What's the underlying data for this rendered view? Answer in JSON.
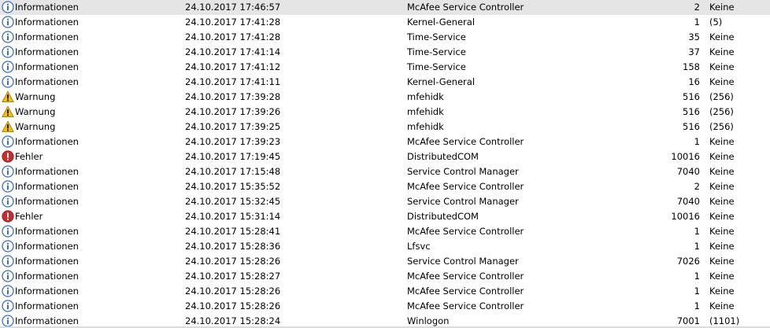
{
  "colors": {
    "selected_row": "#e5e5e5",
    "info_icon": "#3a6fbf",
    "warning_icon": "#f2c200",
    "error_icon": "#cc2b2b"
  },
  "events": [
    {
      "level": "Informationen",
      "icon": "info-icon",
      "datetime": "24.10.2017 17:46:57",
      "source": "McAfee Service Controller",
      "event_id": "2",
      "task_category": "Keine",
      "selected": true
    },
    {
      "level": "Informationen",
      "icon": "info-icon",
      "datetime": "24.10.2017 17:41:28",
      "source": "Kernel-General",
      "event_id": "1",
      "task_category": "(5)"
    },
    {
      "level": "Informationen",
      "icon": "info-icon",
      "datetime": "24.10.2017 17:41:28",
      "source": "Time-Service",
      "event_id": "35",
      "task_category": "Keine"
    },
    {
      "level": "Informationen",
      "icon": "info-icon",
      "datetime": "24.10.2017 17:41:14",
      "source": "Time-Service",
      "event_id": "37",
      "task_category": "Keine"
    },
    {
      "level": "Informationen",
      "icon": "info-icon",
      "datetime": "24.10.2017 17:41:12",
      "source": "Time-Service",
      "event_id": "158",
      "task_category": "Keine"
    },
    {
      "level": "Informationen",
      "icon": "info-icon",
      "datetime": "24.10.2017 17:41:11",
      "source": "Kernel-General",
      "event_id": "16",
      "task_category": "Keine"
    },
    {
      "level": "Warnung",
      "icon": "warning-icon",
      "datetime": "24.10.2017 17:39:28",
      "source": "mfehidk",
      "event_id": "516",
      "task_category": "(256)"
    },
    {
      "level": "Warnung",
      "icon": "warning-icon",
      "datetime": "24.10.2017 17:39:26",
      "source": "mfehidk",
      "event_id": "516",
      "task_category": "(256)"
    },
    {
      "level": "Warnung",
      "icon": "warning-icon",
      "datetime": "24.10.2017 17:39:25",
      "source": "mfehidk",
      "event_id": "516",
      "task_category": "(256)"
    },
    {
      "level": "Informationen",
      "icon": "info-icon",
      "datetime": "24.10.2017 17:39:23",
      "source": "McAfee Service Controller",
      "event_id": "1",
      "task_category": "Keine"
    },
    {
      "level": "Fehler",
      "icon": "error-icon",
      "datetime": "24.10.2017 17:19:45",
      "source": "DistributedCOM",
      "event_id": "10016",
      "task_category": "Keine"
    },
    {
      "level": "Informationen",
      "icon": "info-icon",
      "datetime": "24.10.2017 17:15:48",
      "source": "Service Control Manager",
      "event_id": "7040",
      "task_category": "Keine"
    },
    {
      "level": "Informationen",
      "icon": "info-icon",
      "datetime": "24.10.2017 15:35:52",
      "source": "McAfee Service Controller",
      "event_id": "2",
      "task_category": "Keine"
    },
    {
      "level": "Informationen",
      "icon": "info-icon",
      "datetime": "24.10.2017 15:32:45",
      "source": "Service Control Manager",
      "event_id": "7040",
      "task_category": "Keine"
    },
    {
      "level": "Fehler",
      "icon": "error-icon",
      "datetime": "24.10.2017 15:31:14",
      "source": "DistributedCOM",
      "event_id": "10016",
      "task_category": "Keine"
    },
    {
      "level": "Informationen",
      "icon": "info-icon",
      "datetime": "24.10.2017 15:28:41",
      "source": "McAfee Service Controller",
      "event_id": "1",
      "task_category": "Keine"
    },
    {
      "level": "Informationen",
      "icon": "info-icon",
      "datetime": "24.10.2017 15:28:36",
      "source": "Lfsvc",
      "event_id": "1",
      "task_category": "Keine"
    },
    {
      "level": "Informationen",
      "icon": "info-icon",
      "datetime": "24.10.2017 15:28:26",
      "source": "Service Control Manager",
      "event_id": "7026",
      "task_category": "Keine"
    },
    {
      "level": "Informationen",
      "icon": "info-icon",
      "datetime": "24.10.2017 15:28:27",
      "source": "McAfee Service Controller",
      "event_id": "1",
      "task_category": "Keine"
    },
    {
      "level": "Informationen",
      "icon": "info-icon",
      "datetime": "24.10.2017 15:28:26",
      "source": "McAfee Service Controller",
      "event_id": "1",
      "task_category": "Keine"
    },
    {
      "level": "Informationen",
      "icon": "info-icon",
      "datetime": "24.10.2017 15:28:26",
      "source": "McAfee Service Controller",
      "event_id": "1",
      "task_category": "Keine"
    },
    {
      "level": "Informationen",
      "icon": "info-icon",
      "datetime": "24.10.2017 15:28:24",
      "source": "Winlogon",
      "event_id": "7001",
      "task_category": "(1101)"
    }
  ]
}
